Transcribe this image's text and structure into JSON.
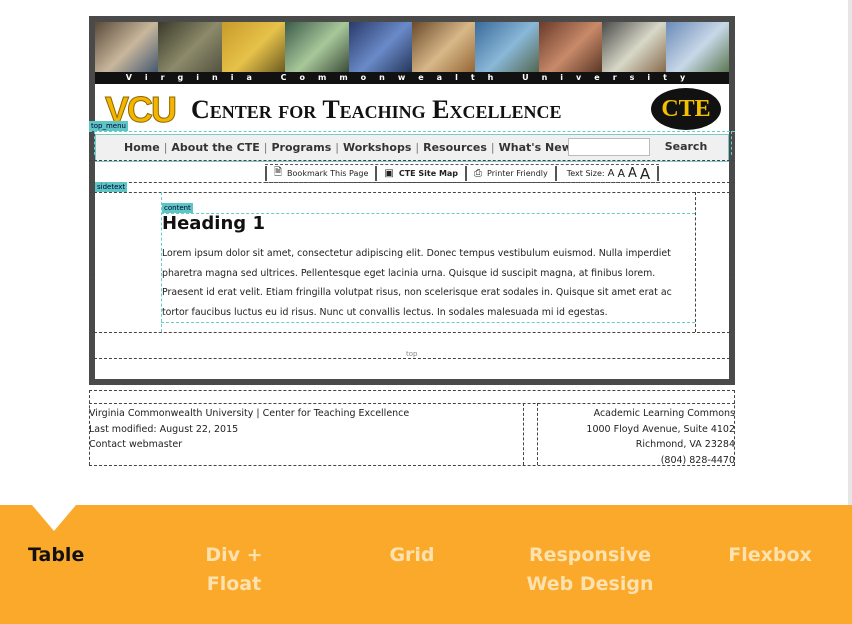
{
  "header": {
    "university_bar": "Virginia Commonwealth University",
    "logo_vcu": "VCU",
    "logo_title": "Center for Teaching Excellence",
    "logo_badge": "CTE"
  },
  "nav": {
    "items": [
      {
        "label": "Home"
      },
      {
        "label": "About the CTE"
      },
      {
        "label": "Programs"
      },
      {
        "label": "Workshops"
      },
      {
        "label": "Resources"
      },
      {
        "label": "What's New"
      }
    ],
    "separator": "|",
    "search_placeholder": "",
    "search_button": "Search"
  },
  "utility": {
    "bookmark": "Bookmark This Page",
    "sitemap": "CTE Site Map",
    "printer": "Printer Friendly",
    "text_size_label": "Text Size:",
    "sizes": [
      "A",
      "A",
      "A",
      "A"
    ]
  },
  "layout_tags": {
    "top_menu": "top_menu",
    "sidetext": "sidetext",
    "content": "content"
  },
  "content": {
    "heading": "Heading 1",
    "lines": [
      "Lorem ipsum dolor sit amet, consectetur adipiscing elit. Donec tempus vestibulum euismod. Nulla imperdiet",
      "pharetra magna sed ultrices. Pellentesque eget lacinia urna. Quisque id suscipit magna, at finibus lorem.",
      "Praesent id erat velit. Etiam fringilla volutpat risus, non scelerisque erat sodales in. Quisque sit amet erat ac",
      "tortor faucibus luctus eu id risus. Nunc ut convallis lectus. In sodales malesuada mi id egestas."
    ],
    "top_link": "top"
  },
  "footer": {
    "left_lines": [
      "Virginia Commonwealth University | Center for Teaching Excellence",
      "Last modified: August 22, 2015",
      "Contact webmaster"
    ],
    "right_lines": [
      "Academic Learning Commons",
      "1000 Floyd Avenue, Suite 4102",
      "Richmond, VA 23284",
      "(804) 828-4470"
    ]
  },
  "tabs": [
    {
      "label": "Table",
      "active": true
    },
    {
      "label": "Div + Float",
      "active": false
    },
    {
      "label": "Grid",
      "active": false
    },
    {
      "label": "Responsive Web Design",
      "active": false
    },
    {
      "label": "Flexbox",
      "active": false
    }
  ],
  "colors": {
    "tab_bar": "#fba92b",
    "tab_active": "#111111",
    "tab_inactive": "#fde2b0",
    "tag_bg": "#5ec5c5",
    "vcu_gold": "#f4b400"
  }
}
